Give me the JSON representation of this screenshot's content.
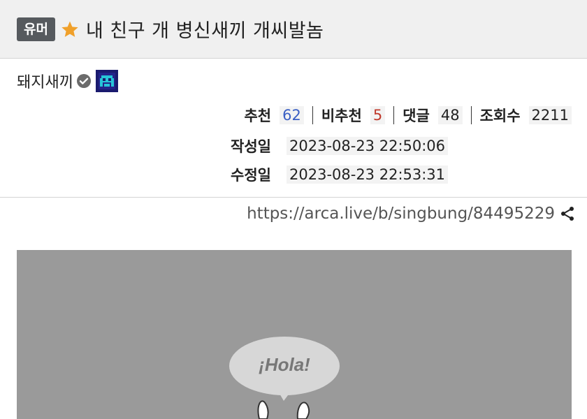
{
  "header": {
    "category": "유머",
    "title": "내 친구 개 병신새끼 개씨발놈"
  },
  "author": {
    "name": "돼지새끼"
  },
  "stats": {
    "upvote_label": "추천",
    "upvote_value": "62",
    "downvote_label": "비추천",
    "downvote_value": "5",
    "comments_label": "댓글",
    "comments_value": "48",
    "views_label": "조회수",
    "views_value": "2211"
  },
  "dates": {
    "created_label": "작성일",
    "created_value": "2023-08-23 22:50:06",
    "edited_label": "수정일",
    "edited_value": "2023-08-23 22:53:31"
  },
  "link": {
    "url": "https://arca.live/b/singbung/84495229"
  },
  "content": {
    "speech_text": "¡Hola!"
  },
  "colors": {
    "badge_bg": "#565a5e",
    "star": "#f0a02a",
    "upvote": "#3a5fc4",
    "downvote": "#c0392b",
    "image_bg": "#9a9a9a"
  },
  "icons": [
    "star-icon",
    "verified-icon",
    "author-emblem-icon",
    "share-icon"
  ]
}
